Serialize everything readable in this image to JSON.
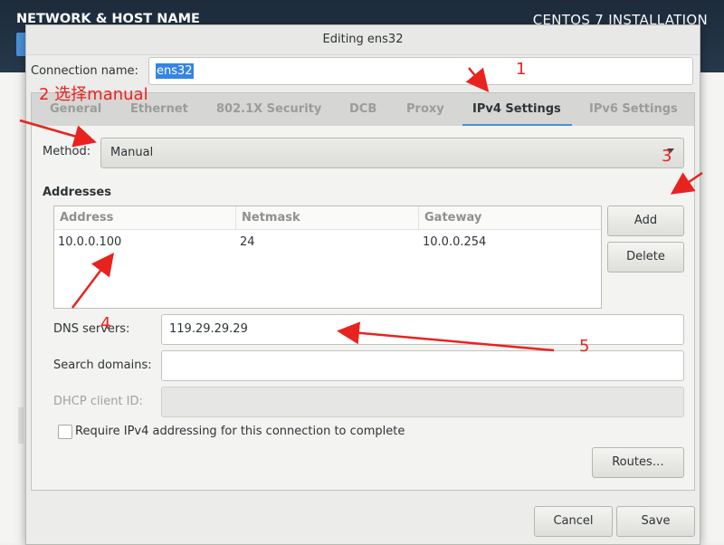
{
  "background": {
    "title_left": "NETWORK & HOST NAME",
    "title_right": "CENTOS 7 INSTALLATION"
  },
  "dialog": {
    "title": "Editing ens32",
    "connection_name_label": "Connection name:",
    "connection_name_value": "ens32",
    "tabs": [
      {
        "label": "General"
      },
      {
        "label": "Ethernet"
      },
      {
        "label": "802.1X Security"
      },
      {
        "label": "DCB"
      },
      {
        "label": "Proxy"
      },
      {
        "label": "IPv4 Settings",
        "active": true
      },
      {
        "label": "IPv6 Settings"
      }
    ],
    "method_label": "Method:",
    "method_value": "Manual",
    "addresses_label": "Addresses",
    "table": {
      "headers": [
        "Address",
        "Netmask",
        "Gateway"
      ],
      "rows": [
        [
          "10.0.0.100",
          "24",
          "10.0.0.254"
        ]
      ]
    },
    "add_button": "Add",
    "delete_button": "Delete",
    "dns_label": "DNS servers:",
    "dns_value": "119.29.29.29",
    "search_domains_label": "Search domains:",
    "search_domains_value": "",
    "dhcp_client_id_label": "DHCP client ID:",
    "dhcp_client_id_value": "",
    "require_ipv4_label": "Require IPv4 addressing for this connection to complete",
    "require_ipv4_checked": false,
    "routes_button": "Routes…",
    "cancel_button": "Cancel",
    "save_button": "Save"
  },
  "annotations": {
    "a1": "1",
    "a2": "2 选择manual",
    "a3": "3",
    "a4": "4",
    "a5": "5",
    "color": "#e8231f"
  }
}
